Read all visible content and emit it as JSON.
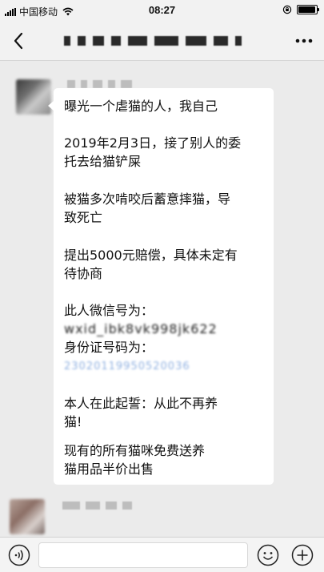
{
  "status_bar": {
    "carrier": "中国移动",
    "time": "08:27"
  },
  "message": {
    "lines": [
      "曝光一个虐猫的人，我自己",
      "2019年2月3日，接了别人的委\n托去给猫铲屎",
      "被猫多次啃咬后蓄意摔猫，导\n致死亡",
      "提出5000元赔偿，具体未定有\n待协商",
      "此人微信号为：",
      "身份证号码为：",
      "本人在此起誓：从此不再养\n猫!",
      "现有的所有猫咪免费送养\n猫用品半价出售"
    ],
    "wechat_id_obscured": "wxid_ibk8vk998jk622",
    "id_number_obscured": "23020119950520036"
  },
  "icons": {
    "back": "back-chevron-icon",
    "more": "more-dots-icon",
    "voice": "voice-icon",
    "emoji": "emoji-icon",
    "plus": "plus-icon"
  },
  "colors": {
    "background": "#ebebeb",
    "bubble": "#ffffff",
    "obscured_link": "#8fb0e0"
  }
}
